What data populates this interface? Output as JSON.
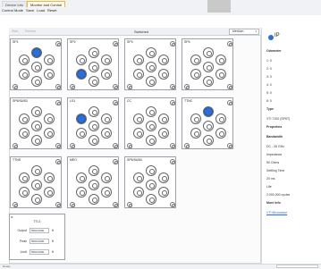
{
  "tabs": [
    "Device Info",
    "Monitor and Control"
  ],
  "menu": [
    "Control Mode",
    "Save",
    "Load",
    "Reset"
  ],
  "toolbar": {
    "left_buttons": [
      "Start",
      "Refresh"
    ],
    "title": "Switched",
    "select_value": "Medium"
  },
  "switches": [
    {
      "name": "SP1"
    },
    {
      "name": "SP2"
    },
    {
      "name": "SP3"
    },
    {
      "name": "SP4"
    },
    {
      "name": "SP6/SUB3"
    },
    {
      "name": "LS1"
    },
    {
      "name": "CC"
    },
    {
      "name": "TTNC"
    },
    {
      "name": "TTNS"
    },
    {
      "name": "MEO"
    },
    {
      "name": "SP6/SUB4"
    },
    {
      "name": ""
    }
  ],
  "panel": {
    "title": "TTL1",
    "rows": [
      {
        "label": "Output",
        "value": "5000.0000",
        "unit": "ft"
      },
      {
        "label": "Peak",
        "value": "5000.0000",
        "unit": "ft"
      },
      {
        "label": "Limit",
        "value": "5000.0000",
        "unit": "ft"
      }
    ]
  },
  "right": {
    "title": "IP",
    "lines": [
      {
        "text": "Odometer",
        "bold": true
      },
      {
        "text": "1: 0"
      },
      {
        "text": "2: 0"
      },
      {
        "text": "3: 0"
      },
      {
        "text": "4: 0"
      },
      {
        "text": "5: 0"
      },
      {
        "text": "6: 0"
      },
      {
        "text": "Type",
        "bold": true
      },
      {
        "text": "VTI 7100 (SP6T)"
      },
      {
        "text": "Properties",
        "bold": true
      },
      {
        "text": "Bandwidth",
        "bold": true
      },
      {
        "text": "DC - 26 GHz"
      },
      {
        "text": "Impedance"
      },
      {
        "text": "50 Ohms"
      },
      {
        "text": "Settling Time"
      },
      {
        "text": "20 ms"
      },
      {
        "text": "Life"
      },
      {
        "text": "2,000,000 cycles"
      },
      {
        "text": "More Info",
        "bold": true
      },
      {
        "text": "VTI Microwave",
        "link": true
      }
    ]
  },
  "status": {
    "text": "Ready"
  }
}
